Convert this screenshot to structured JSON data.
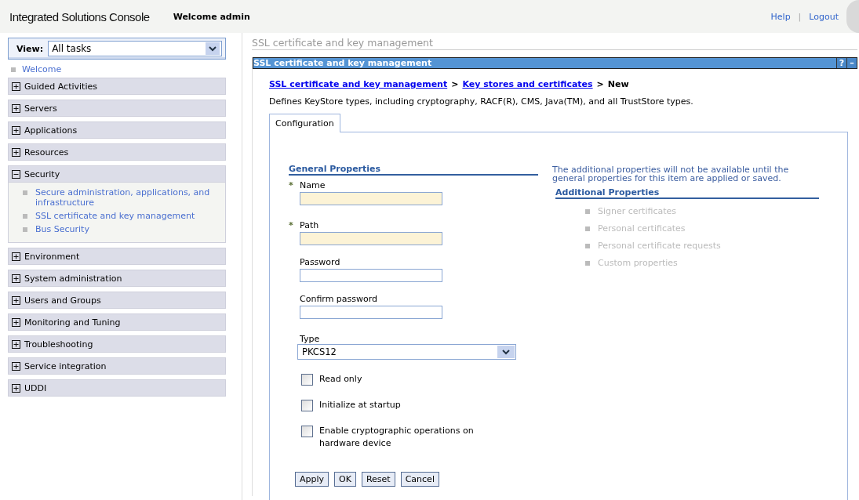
{
  "header": {
    "title": "Integrated Solutions Console",
    "welcome": "Welcome admin",
    "links": [
      "Help",
      "Logout"
    ],
    "separator": "|"
  },
  "sidebar": {
    "view_label": "View:",
    "view_value": "All tasks",
    "welcome": "Welcome",
    "groups": [
      {
        "label": "Guided Activities",
        "expanded": false
      },
      {
        "label": "Servers",
        "expanded": false
      },
      {
        "label": "Applications",
        "expanded": false
      },
      {
        "label": "Resources",
        "expanded": false
      },
      {
        "label": "Security",
        "expanded": true,
        "children": [
          "Secure administration, applications, and infrastructure",
          "SSL certificate and key management",
          "Bus Security"
        ]
      },
      {
        "label": "Environment",
        "expanded": false
      },
      {
        "label": "System administration",
        "expanded": false
      },
      {
        "label": "Users and Groups",
        "expanded": false
      },
      {
        "label": "Monitoring and Tuning",
        "expanded": false
      },
      {
        "label": "Troubleshooting",
        "expanded": false
      },
      {
        "label": "Service integration",
        "expanded": false
      },
      {
        "label": "UDDI",
        "expanded": false
      }
    ]
  },
  "page_title": "SSL certificate and key management",
  "portlet": {
    "title": "SSL certificate and key management",
    "help": "?",
    "minimize": "–",
    "breadcrumb": [
      "SSL certificate and key management",
      "Key stores and certificates"
    ],
    "breadcrumb_current": "New",
    "breadcrumb_sep": ">",
    "description": "Defines KeyStore types, including cryptography, RACF(R), CMS, Java(TM), and all TrustStore types.",
    "tabs": [
      {
        "label": "Configuration",
        "selected": true
      }
    ],
    "general_heading": "General Properties",
    "fields": [
      {
        "label": "Name",
        "required": true
      },
      {
        "label": "Path",
        "required": true
      },
      {
        "label": "Password",
        "required": false
      },
      {
        "label": "Confirm password",
        "required": false
      }
    ],
    "required_mark": "*",
    "type_label": "Type",
    "type_value": "PKCS12",
    "checkboxes": [
      {
        "label": "Read only",
        "checked": false
      },
      {
        "label": "Initialize at startup",
        "checked": false
      },
      {
        "label": "Enable cryptographic operations on hardware device",
        "checked": false
      }
    ],
    "buttons": [
      "Apply",
      "OK",
      "Reset",
      "Cancel"
    ],
    "additional_note": "The additional properties will not be available until the general properties for this item are applied or saved.",
    "additional_heading": "Additional Properties",
    "additional_items": [
      {
        "label": "Signer certificates",
        "disabled": true
      },
      {
        "label": "Personal certificates",
        "disabled": true
      },
      {
        "label": "Personal certificate requests",
        "disabled": true
      },
      {
        "label": "Custom properties",
        "disabled": true
      }
    ]
  }
}
